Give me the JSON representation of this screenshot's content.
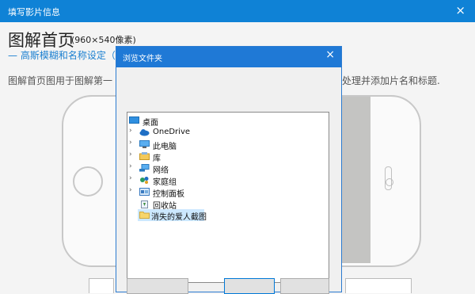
{
  "app": {
    "title": "填写影片信息",
    "close_glyph": "×"
  },
  "page": {
    "title": "图解首页",
    "size_label": "(960×540像素)",
    "subtitle": "— 高斯模糊和名称设定（",
    "description_left": "图解首页图用于图解第一",
    "description_right": "处理并添加片名和标题."
  },
  "dialog": {
    "title": "浏览文件夹",
    "close_glyph": "×",
    "tree": [
      {
        "label": "桌面",
        "icon": "desktop-icon",
        "chevron": false,
        "selected": false
      },
      {
        "label": "OneDrive",
        "icon": "onedrive-cloud-icon",
        "chevron": true,
        "selected": false
      },
      {
        "label": "此电脑",
        "icon": "computer-icon",
        "chevron": true,
        "selected": false
      },
      {
        "label": "库",
        "icon": "library-icon",
        "chevron": true,
        "selected": false
      },
      {
        "label": "网络",
        "icon": "network-icon",
        "chevron": true,
        "selected": false
      },
      {
        "label": "家庭组",
        "icon": "homegroup-icon",
        "chevron": true,
        "selected": false
      },
      {
        "label": "控制面板",
        "icon": "control-panel-icon",
        "chevron": true,
        "selected": false
      },
      {
        "label": "回收站",
        "icon": "recycle-bin-icon",
        "chevron": false,
        "selected": false
      },
      {
        "label": "消失的爱人截图",
        "icon": "folder-icon",
        "chevron": false,
        "selected": true
      }
    ]
  },
  "colors": {
    "accent": "#0f82d6",
    "selection": "#cce8ff",
    "subtitle": "#1a7fd0"
  }
}
